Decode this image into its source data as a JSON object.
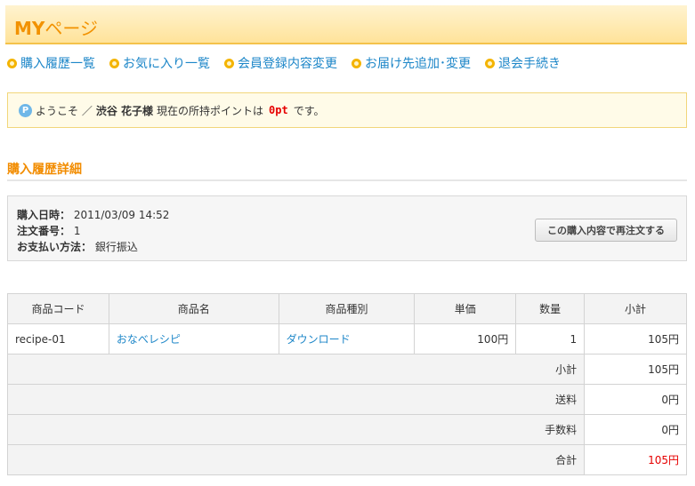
{
  "header": {
    "title_bold": "MY",
    "title_rest": "ページ"
  },
  "nav": [
    {
      "label": "購入履歴一覧"
    },
    {
      "label": "お気に入り一覧"
    },
    {
      "label": "会員登録内容変更"
    },
    {
      "label": "お届け先追加･変更"
    },
    {
      "label": "退会手続き"
    }
  ],
  "welcome": {
    "icon": "P",
    "prefix": "ようこそ ／",
    "name": "渋谷 花子様",
    "middle": "現在の所持ポイントは",
    "points": "0pt",
    "suffix": "です。"
  },
  "section_title": "購入履歴詳細",
  "order_info": {
    "date_label": "購入日時：",
    "date_value": "2011/03/09 14:52",
    "number_label": "注文番号：",
    "number_value": "1",
    "payment_label": "お支払い方法：",
    "payment_value": "銀行振込",
    "reorder_button": "この購入内容で再注文する"
  },
  "table": {
    "headers": [
      "商品コード",
      "商品名",
      "商品種別",
      "単価",
      "数量",
      "小計"
    ],
    "rows": [
      {
        "code": "recipe-01",
        "name": "おなべレシピ",
        "type": "ダウンロード",
        "price": "100円",
        "qty": "1",
        "subtotal": "105円"
      }
    ],
    "summary": [
      {
        "label": "小計",
        "value": "105円"
      },
      {
        "label": "送料",
        "value": "0円"
      },
      {
        "label": "手数料",
        "value": "0円"
      },
      {
        "label": "合計",
        "value": "105円"
      }
    ]
  },
  "colors": {
    "accent_orange": "#f28c00",
    "link_blue": "#1c86c8",
    "points_red": "#e60000"
  }
}
